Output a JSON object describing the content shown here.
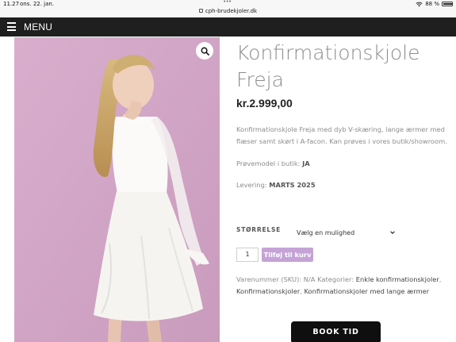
{
  "status_bar": {
    "time": "11.27",
    "date": "ons. 22. jan.",
    "url": "cph-brudekjoler.dk",
    "battery": "88 %",
    "battery_level": 0.88
  },
  "nav": {
    "menu_label": "MENU"
  },
  "product": {
    "title_line1": "Konfirmationskjole",
    "title_line2": "Freja",
    "price": "kr.2.999,00",
    "description": "Konfirmationskjole Freja med dyb V-skæring, lange ærmer med flæser samt skørt i A-facon. Kan prøves i vores butik/showroom.",
    "sample_label": "Prøvemodel i butik:",
    "sample_value": "JA",
    "delivery_label": "Levering:",
    "delivery_value": "MARTS 2025"
  },
  "variation": {
    "label": "STØRRELSE",
    "selected": "Vælg en mulighed"
  },
  "cart": {
    "quantity": "1",
    "add_label": "Tilføj til kurv"
  },
  "meta": {
    "sku_label": "Varenummer (SKU):",
    "sku_value": "N/A",
    "categories_label": "Kategorier:",
    "category_1": "Enkle konfirmationskjoler",
    "category_2": "Konfirmationskjoler",
    "category_3": "Konfirmationskjoler med lange ærmer"
  },
  "book_button": "BOOK TID",
  "colors": {
    "nav_bg": "#1f1f1f",
    "image_bg": "#d3a5c7",
    "add_to_cart": "#c5a3d6",
    "title": "#8d8d8d"
  },
  "icons": [
    "wifi-icon",
    "battery-icon",
    "lock-icon",
    "hamburger-icon",
    "search-icon",
    "chevron-down-icon"
  ]
}
